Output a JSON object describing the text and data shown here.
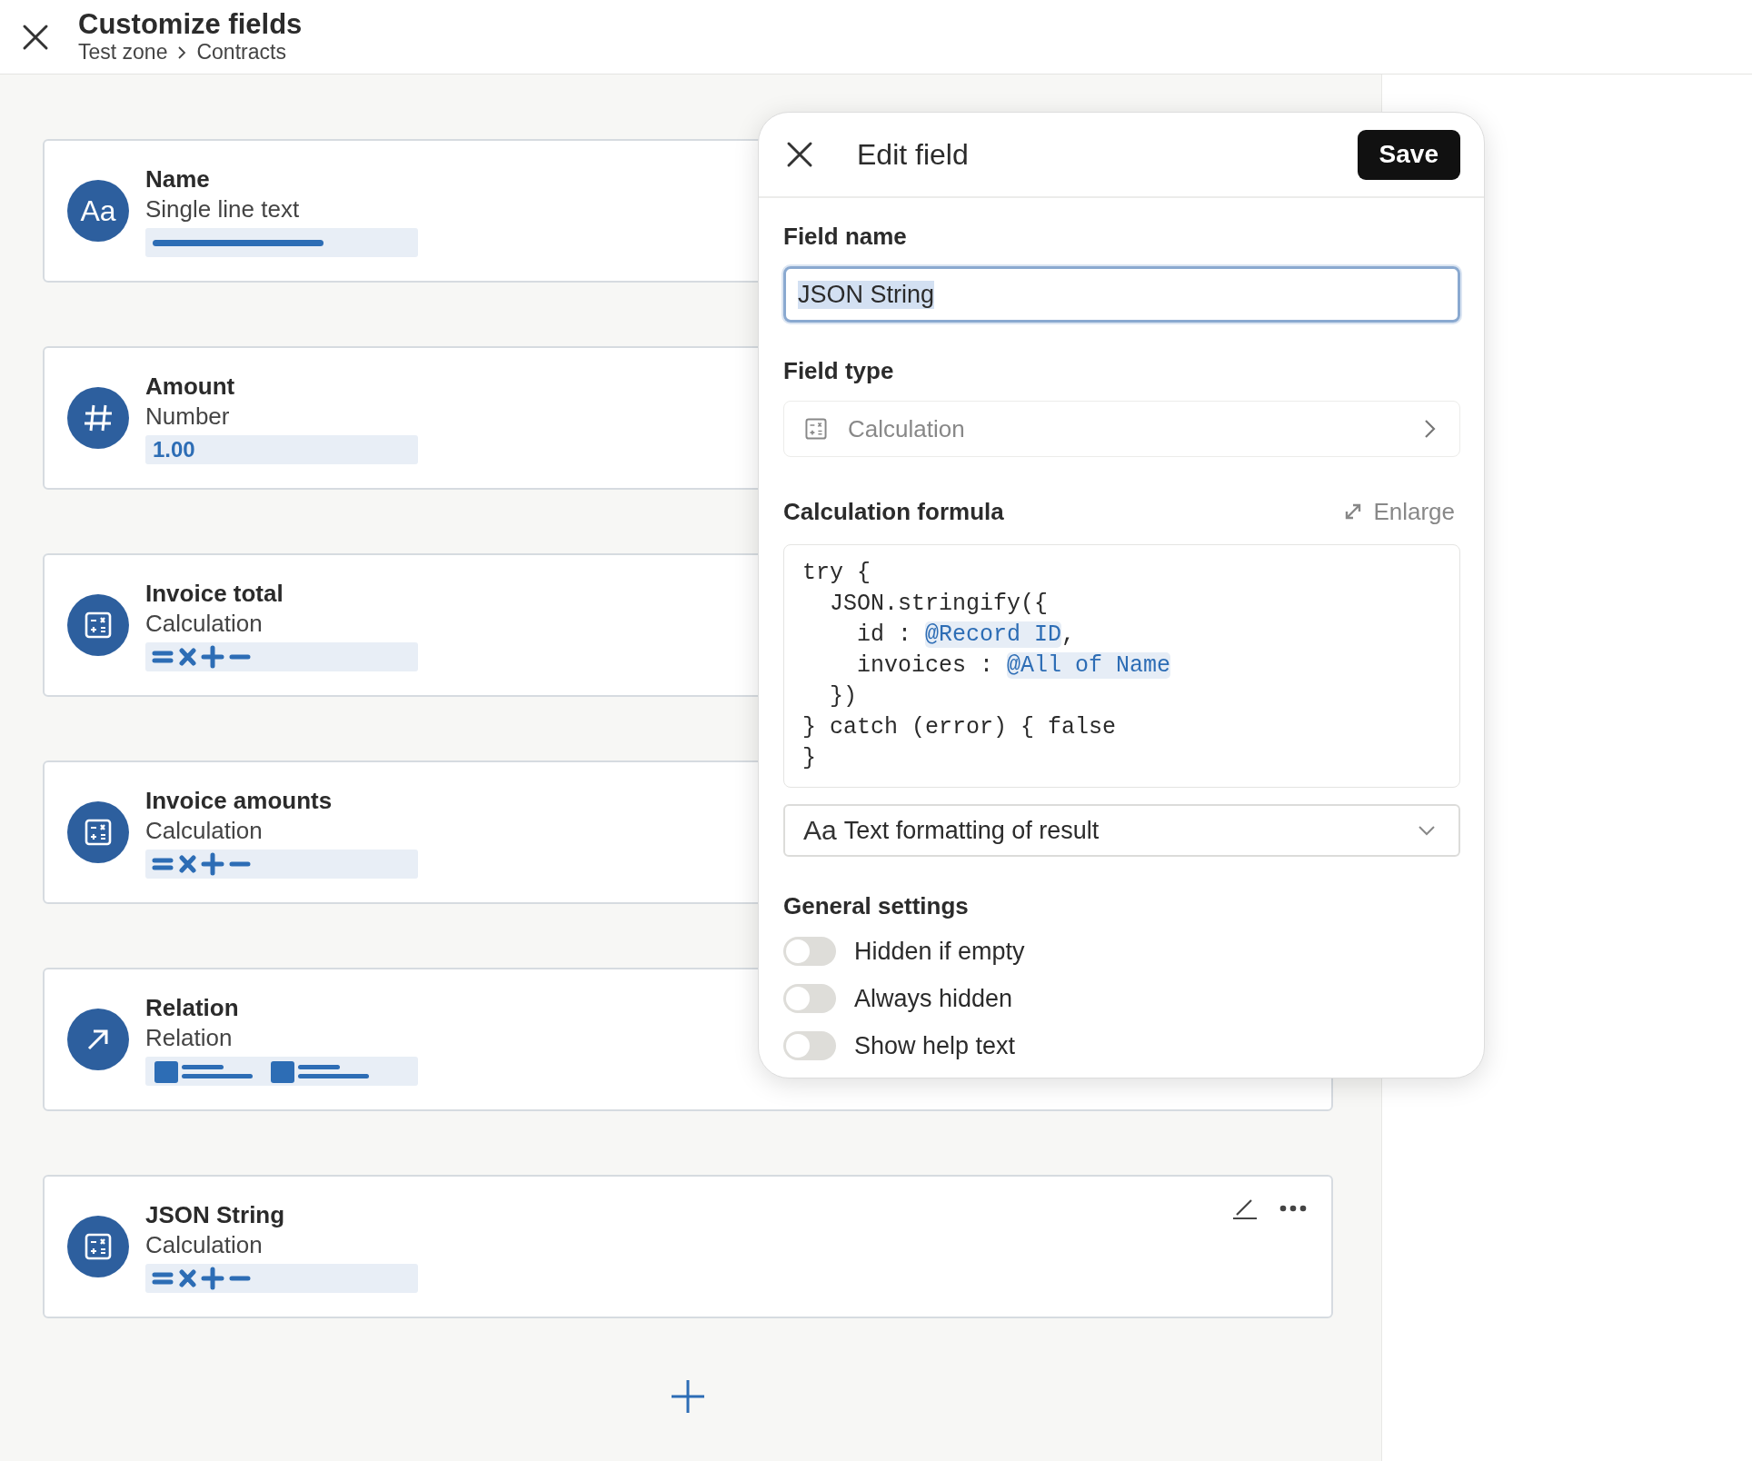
{
  "header": {
    "title": "Customize fields",
    "breadcrumb": [
      "Test zone",
      "Contracts"
    ]
  },
  "fields": [
    {
      "name": "Name",
      "type": "Single line text",
      "kind": "text",
      "icon_text": "Aa"
    },
    {
      "name": "Amount",
      "type": "Number",
      "kind": "number",
      "preview": "1.00"
    },
    {
      "name": "Invoice total",
      "type": "Calculation",
      "kind": "calculation"
    },
    {
      "name": "Invoice amounts",
      "type": "Calculation",
      "kind": "calculation"
    },
    {
      "name": "Relation",
      "type": "Relation",
      "kind": "relation"
    },
    {
      "name": "JSON String",
      "type": "Calculation",
      "kind": "calculation",
      "actions": true
    }
  ],
  "edit_panel": {
    "title": "Edit field",
    "save": "Save",
    "field_name_label": "Field name",
    "field_name_value": "JSON String",
    "field_name_selected": true,
    "field_type_label": "Field type",
    "field_type_value": "Calculation",
    "formula_label": "Calculation formula",
    "enlarge": "Enlarge",
    "formula_lines": [
      [
        {
          "kind": "code",
          "text": "try {"
        }
      ],
      [
        {
          "kind": "code",
          "text": "  JSON.stringify({"
        }
      ],
      [
        {
          "kind": "code",
          "text": "    id : "
        },
        {
          "kind": "mention",
          "text": "@Record ID"
        },
        {
          "kind": "code",
          "text": ","
        }
      ],
      [
        {
          "kind": "code",
          "text": "    invoices : "
        },
        {
          "kind": "mention",
          "text": "@All of Name"
        }
      ],
      [
        {
          "kind": "code",
          "text": "  })"
        }
      ],
      [
        {
          "kind": "code",
          "text": "} catch (error) { false"
        }
      ],
      [
        {
          "kind": "code",
          "text": "}"
        }
      ]
    ],
    "format_prefix": "Aa",
    "format_value": "Text formatting of result",
    "general_label": "General settings",
    "settings": [
      {
        "label": "Hidden if empty",
        "on": false
      },
      {
        "label": "Always hidden",
        "on": false
      },
      {
        "label": "Show help text",
        "on": false
      }
    ]
  }
}
